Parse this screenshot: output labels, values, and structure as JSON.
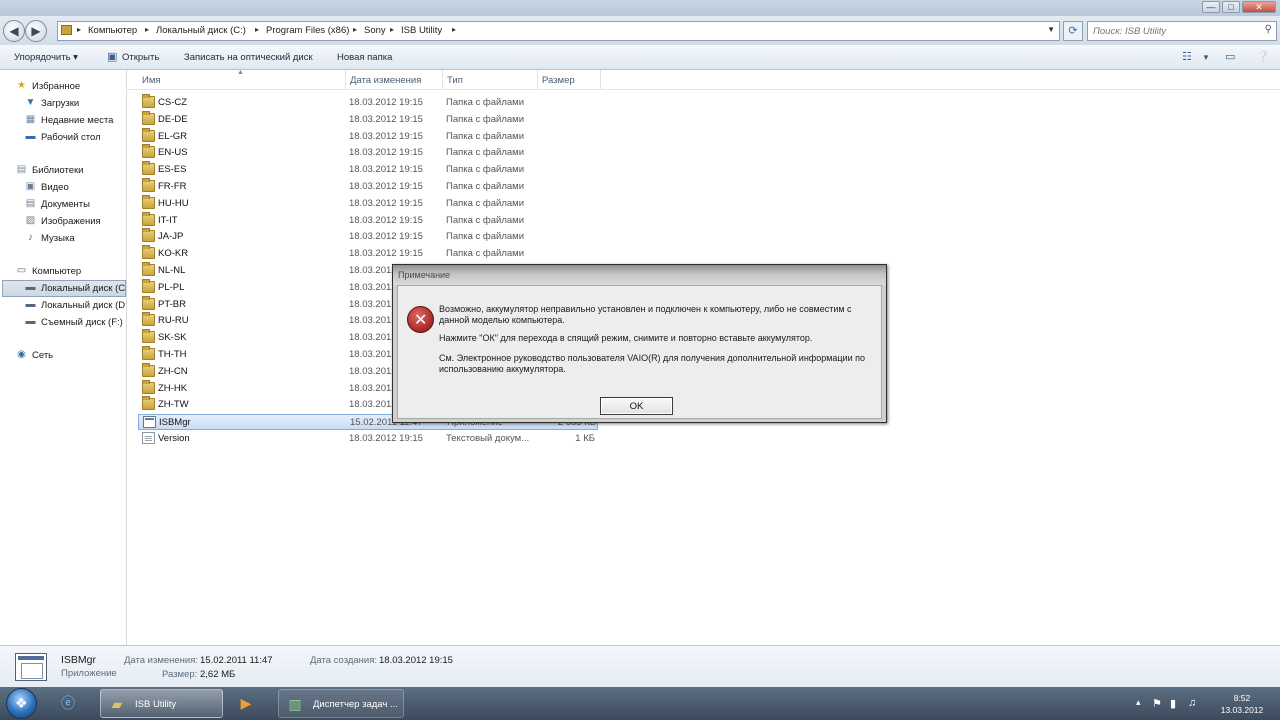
{
  "window": {
    "buttons": {
      "minimize": "—",
      "maximize": "□",
      "close": "✕"
    }
  },
  "address": {
    "crumbs": [
      "Компьютер",
      "Локальный диск (C:)",
      "Program Files (x86)",
      "Sony",
      "ISB Utility"
    ],
    "search_placeholder": "Поиск: ISB Utility"
  },
  "toolbar": {
    "organize": "Упорядочить ▾",
    "open": "Открыть",
    "burn": "Записать на оптический диск",
    "new_folder": "Новая папка"
  },
  "nav": {
    "favorites": {
      "label": "Избранное",
      "items": [
        "Загрузки",
        "Недавние места",
        "Рабочий стол"
      ]
    },
    "libraries": {
      "label": "Библиотеки",
      "items": [
        "Видео",
        "Документы",
        "Изображения",
        "Музыка"
      ]
    },
    "computer": {
      "label": "Компьютер",
      "items": [
        "Локальный диск (C",
        "Локальный диск (D",
        "Съемный диск (F:)"
      ]
    },
    "network": {
      "label": "Сеть"
    }
  },
  "columns": {
    "name": "Имя",
    "date": "Дата изменения",
    "type": "Тип",
    "size": "Размер"
  },
  "files": [
    {
      "name": "CS-CZ",
      "date": "18.03.2012 19:15",
      "type": "Папка с файлами",
      "size": "",
      "kind": "folder"
    },
    {
      "name": "DE-DE",
      "date": "18.03.2012 19:15",
      "type": "Папка с файлами",
      "size": "",
      "kind": "folder"
    },
    {
      "name": "EL-GR",
      "date": "18.03.2012 19:15",
      "type": "Папка с файлами",
      "size": "",
      "kind": "folder"
    },
    {
      "name": "EN-US",
      "date": "18.03.2012 19:15",
      "type": "Папка с файлами",
      "size": "",
      "kind": "folder"
    },
    {
      "name": "ES-ES",
      "date": "18.03.2012 19:15",
      "type": "Папка с файлами",
      "size": "",
      "kind": "folder"
    },
    {
      "name": "FR-FR",
      "date": "18.03.2012 19:15",
      "type": "Папка с файлами",
      "size": "",
      "kind": "folder"
    },
    {
      "name": "HU-HU",
      "date": "18.03.2012 19:15",
      "type": "Папка с файлами",
      "size": "",
      "kind": "folder"
    },
    {
      "name": "IT-IT",
      "date": "18.03.2012 19:15",
      "type": "Папка с файлами",
      "size": "",
      "kind": "folder"
    },
    {
      "name": "JA-JP",
      "date": "18.03.2012 19:15",
      "type": "Папка с файлами",
      "size": "",
      "kind": "folder"
    },
    {
      "name": "KO-KR",
      "date": "18.03.2012 19:15",
      "type": "Папка с файлами",
      "size": "",
      "kind": "folder"
    },
    {
      "name": "NL-NL",
      "date": "18.03.2012 19:15",
      "type": "",
      "size": "",
      "kind": "folder"
    },
    {
      "name": "PL-PL",
      "date": "18.03.2012 19:15",
      "type": "",
      "size": "",
      "kind": "folder"
    },
    {
      "name": "PT-BR",
      "date": "18.03.2012 19:15",
      "type": "",
      "size": "",
      "kind": "folder"
    },
    {
      "name": "RU-RU",
      "date": "18.03.2012 19:15",
      "type": "",
      "size": "",
      "kind": "folder"
    },
    {
      "name": "SK-SK",
      "date": "18.03.2012 19:15",
      "type": "",
      "size": "",
      "kind": "folder"
    },
    {
      "name": "TH-TH",
      "date": "18.03.2012 19:15",
      "type": "",
      "size": "",
      "kind": "folder"
    },
    {
      "name": "ZH-CN",
      "date": "18.03.2012 19:15",
      "type": "",
      "size": "",
      "kind": "folder"
    },
    {
      "name": "ZH-HK",
      "date": "18.03.2012 19:15",
      "type": "",
      "size": "",
      "kind": "folder"
    },
    {
      "name": "ZH-TW",
      "date": "18.03.2012 19:15",
      "type": "",
      "size": "",
      "kind": "folder"
    },
    {
      "name": "ISBMgr",
      "date": "15.02.2011 11:47",
      "type": "Приложение",
      "size": "2 683 КБ",
      "kind": "app",
      "selected": true
    },
    {
      "name": "Version",
      "date": "18.03.2012 19:15",
      "type": "Текстовый докум...",
      "size": "1 КБ",
      "kind": "text"
    }
  ],
  "details": {
    "name": "ISBMgr",
    "kind": "Приложение",
    "modified_label": "Дата изменения:",
    "modified": "15.02.2011 11:47",
    "size_label": "Размер:",
    "size": "2,62 МБ",
    "created_label": "Дата создания:",
    "created": "18.03.2012 19:15"
  },
  "dialog": {
    "title": "Примечание",
    "message1": "Возможно, аккумулятор неправильно установлен и подключен к компьютеру, либо не совместим с данной моделью компьютера.",
    "message2": "Нажмите \"ОК\" для перехода в спящий режим, снимите и повторно вставьте аккумулятор.",
    "message3": "См. Электронное руководство пользователя VAIO(R) для получения дополнительной информации по использованию аккумулятора.",
    "ok_label": "OK"
  },
  "taskbar": {
    "apps": [
      {
        "label": "",
        "icon": "ie-icon"
      },
      {
        "label": "ISB Utility",
        "icon": "folder-icon",
        "active": true
      },
      {
        "label": "",
        "icon": "media-player-icon"
      },
      {
        "label": "Диспетчер задач ...",
        "icon": "task-manager-icon"
      }
    ],
    "time": "8:52",
    "date": "13.03.2012"
  },
  "colors": {
    "selection": "#c8dcf3",
    "taskbar": "#3b4a5c",
    "dialog_face": "#ededed",
    "error_icon": "#b0302e"
  }
}
